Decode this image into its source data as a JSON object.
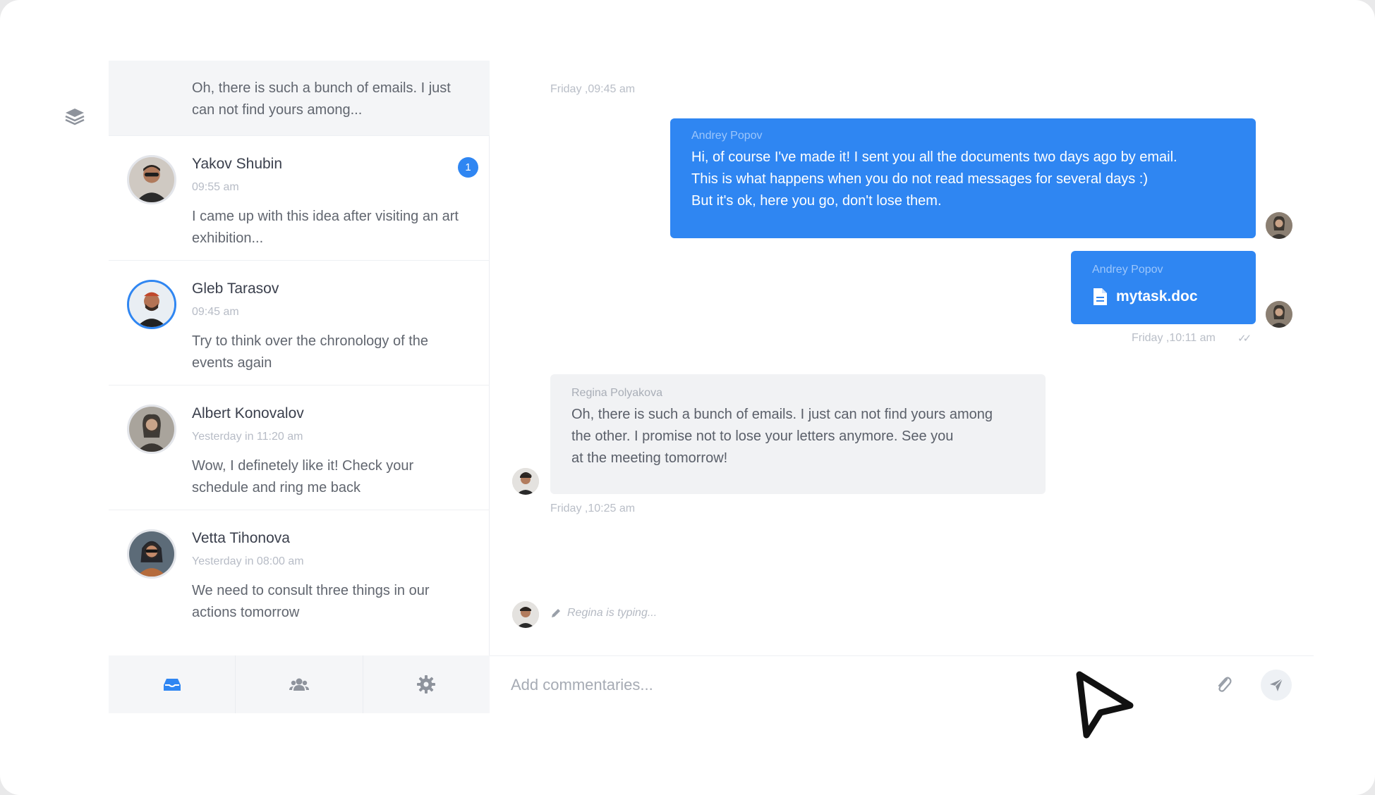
{
  "contacts": {
    "partial": {
      "message": "Oh, there is such a bunch of emails. I just can not find yours among..."
    },
    "items": [
      {
        "name": "Yakov Shubin",
        "time": "09:55 am",
        "message": "I came up with this idea after visiting an art exhibition...",
        "badge": "1"
      },
      {
        "name": "Gleb Tarasov",
        "time": "09:45 am",
        "message": "Try to think over the chronology of the events again"
      },
      {
        "name": "Albert Konovalov",
        "time": "Yesterday in 11:20 am",
        "message": "Wow, I definetely like it! Check your schedule and ring me back"
      },
      {
        "name": "Vetta Tihonova",
        "time": "Yesterday in 08:00 am",
        "message": "We need to consult three things in our actions tomorrow"
      }
    ],
    "tabs": [
      {
        "icon": "inbox-icon"
      },
      {
        "icon": "group-icon"
      },
      {
        "icon": "gear-icon"
      }
    ]
  },
  "chat": {
    "top_timestamp": "Friday ,09:45 am",
    "message1": {
      "sender": "Andrey Popov",
      "lines": [
        "Hi, of course I've made it! I sent you all the documents two days ago by email.",
        "This is what happens when you do not read messages for several days :)",
        "But it's ok, here you go, don't lose them."
      ]
    },
    "message2": {
      "sender": "Andrey Popov",
      "file_name": "mytask.doc",
      "timestamp": "Friday ,10:11 am"
    },
    "message3": {
      "sender": "Regina Polyakova",
      "lines": [
        "Oh, there is such a bunch of emails. I just can not find yours among",
        "the other. I promise not to lose your letters anymore. See you",
        "at the meeting tomorrow!"
      ],
      "timestamp": "Friday ,10:25 am"
    },
    "typing": "Regina is typing...",
    "composer": {
      "placeholder": "Add commentaries..."
    }
  },
  "colors": {
    "accent": "#2f86f2",
    "incoming_bubble": "#f1f2f4"
  }
}
